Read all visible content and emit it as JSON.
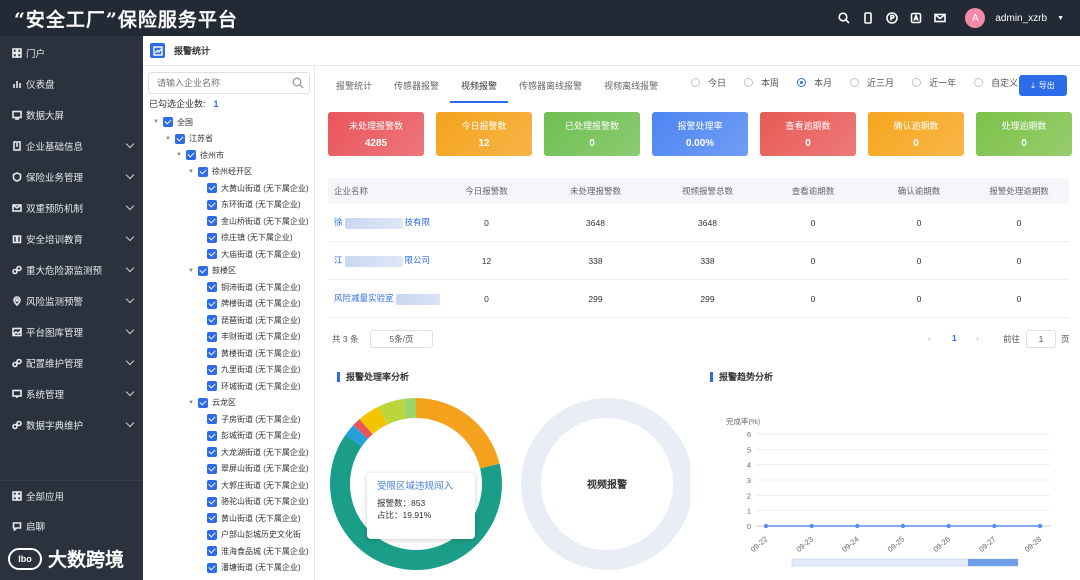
{
  "app": {
    "title": "“安全工厂”保险服务平台"
  },
  "user": {
    "avatar_letter": "A",
    "name": "admin_xzrb"
  },
  "sidebar": {
    "items": [
      {
        "label": "门户",
        "icon": "grid-icon"
      },
      {
        "label": "仪表盘",
        "icon": "chart-icon"
      },
      {
        "label": "数据大屏",
        "icon": "screen-icon"
      },
      {
        "label": "企业基础信息",
        "icon": "building-icon"
      },
      {
        "label": "保险业务管理",
        "icon": "shield-icon"
      },
      {
        "label": "双重预防机制",
        "icon": "mail-icon"
      },
      {
        "label": "安全培训教育",
        "icon": "book-icon"
      },
      {
        "label": "重大危险源监测预",
        "icon": "link-icon"
      },
      {
        "label": "风险监测预警",
        "icon": "pin-icon"
      },
      {
        "label": "平台图库管理",
        "icon": "image-icon"
      },
      {
        "label": "配置维护管理",
        "icon": "link-icon"
      },
      {
        "label": "系统管理",
        "icon": "monitor-icon"
      },
      {
        "label": "数据字典维护",
        "icon": "link-icon"
      }
    ],
    "bottom": [
      {
        "label": "全部应用",
        "icon": "apps-icon"
      },
      {
        "label": "启聊",
        "icon": "chat-icon"
      }
    ]
  },
  "watermark": {
    "text": "大数跨境",
    "logo": "lbo"
  },
  "page": {
    "title": "报警统计"
  },
  "tree": {
    "search_placeholder": "请输入企业名称",
    "selected_label": "已勾选企业数:",
    "selected_count": "1",
    "nodes": [
      {
        "label": "全国",
        "level": 0,
        "arrow": true
      },
      {
        "label": "江苏省",
        "level": 1,
        "arrow": true
      },
      {
        "label": "徐州市",
        "level": 2,
        "arrow": true
      },
      {
        "label": "徐州经开区",
        "level": 3,
        "arrow": true
      },
      {
        "label": "大黄山街道 (无下属企业)",
        "level": 4
      },
      {
        "label": "东环街道 (无下属企业)",
        "level": 4
      },
      {
        "label": "金山桥街道 (无下属企业)",
        "level": 4
      },
      {
        "label": "徐庄镇 (无下属企业)",
        "level": 4
      },
      {
        "label": "大庙街道 (无下属企业)",
        "level": 4
      },
      {
        "label": "鼓楼区",
        "level": 3,
        "arrow": true
      },
      {
        "label": "铜沛街道 (无下属企业)",
        "level": 4
      },
      {
        "label": "牌楼街道 (无下属企业)",
        "level": 4
      },
      {
        "label": "琵琶街道 (无下属企业)",
        "level": 4
      },
      {
        "label": "丰财街道 (无下属企业)",
        "level": 4
      },
      {
        "label": "黄楼街道 (无下属企业)",
        "level": 4
      },
      {
        "label": "九里街道 (无下属企业)",
        "level": 4
      },
      {
        "label": "环城街道 (无下属企业)",
        "level": 4
      },
      {
        "label": "云龙区",
        "level": 3,
        "arrow": true
      },
      {
        "label": "子房街道 (无下属企业)",
        "level": 4
      },
      {
        "label": "彭城街道 (无下属企业)",
        "level": 4
      },
      {
        "label": "大龙湖街道 (无下属企业)",
        "level": 4
      },
      {
        "label": "翠屏山街道 (无下属企业)",
        "level": 4
      },
      {
        "label": "大郭庄街道 (无下属企业)",
        "level": 4
      },
      {
        "label": "骆驼山街道 (无下属企业)",
        "level": 4
      },
      {
        "label": "黄山街道 (无下属企业)",
        "level": 4
      },
      {
        "label": "户部山彭城历史文化街",
        "level": 4
      },
      {
        "label": "淮海食品城 (无下属企业)",
        "level": 4
      },
      {
        "label": "潘塘街道 (无下属企业)",
        "level": 4
      }
    ]
  },
  "tabs": [
    "报警统计",
    "传感器报警",
    "视频报警",
    "传感器离线报警",
    "视频离线报警"
  ],
  "active_tab": 2,
  "radios": [
    "今日",
    "本周",
    "本月",
    "近三月",
    "近一年",
    "自定义"
  ],
  "active_radio": 2,
  "export_label": "导出",
  "cards": [
    {
      "label": "未处理报警数",
      "value": "4285",
      "color": "#e9545a"
    },
    {
      "label": "今日报警数",
      "value": "12",
      "color": "#f4a21b"
    },
    {
      "label": "已处理报警数",
      "value": "0",
      "color": "#6fbf50"
    },
    {
      "label": "报警处理率",
      "value": "0.00%",
      "color": "#4d85f2"
    },
    {
      "label": "查看逾期数",
      "value": "0",
      "color": "#e85a56"
    },
    {
      "label": "确认逾期数",
      "value": "0",
      "color": "#f6a51c"
    },
    {
      "label": "处理逾期数",
      "value": "0",
      "color": "#7cc148"
    }
  ],
  "table": {
    "headers": [
      "企业名称",
      "今日报警数",
      "未处理报警数",
      "视频报警总数",
      "查看逾期数",
      "确认逾期数",
      "报警处理逾期数"
    ],
    "rows": [
      {
        "name_a": "徐",
        "name_b": "技有限",
        "cells": [
          "0",
          "3648",
          "3648",
          "0",
          "0",
          "0"
        ]
      },
      {
        "name_a": "江",
        "name_b": "限公司",
        "cells": [
          "12",
          "338",
          "338",
          "0",
          "0",
          "0"
        ]
      },
      {
        "name_a": "风险减量实验室",
        "name_b": "",
        "cells": [
          "0",
          "299",
          "299",
          "0",
          "0",
          "0"
        ]
      }
    ]
  },
  "pager": {
    "total": "共 3 条",
    "size": "5条/页",
    "current": "1",
    "goto_label": "前往",
    "goto_value": "1",
    "page_unit": "页"
  },
  "panels": {
    "left_title": "报警处理率分析",
    "right_title": "报警趋势分析",
    "donut_center": "视频报警"
  },
  "tooltip": {
    "title": "受限区域违规闯入",
    "line1": "报警数：853",
    "line2": "占比：19.91%"
  },
  "chart_data": [
    {
      "type": "pie",
      "categories": [
        "受限区域违规闯入",
        "",
        "",
        "",
        "",
        "",
        ""
      ],
      "values": [
        19.91,
        59.5,
        2.2,
        1.5,
        4.0,
        4.5,
        2.2
      ],
      "colors": [
        "#f4a21b",
        "#1a9e88",
        "#26a0da",
        "#e9545a",
        "#f5c400",
        "#bcd53b",
        "#9bd56a"
      ]
    },
    {
      "type": "line",
      "title": "",
      "ylabel": "完成率(%)",
      "x": [
        "09-22",
        "09-23",
        "09-24",
        "09-25",
        "09-26",
        "09-27",
        "09-28"
      ],
      "series": [
        {
          "values": [
            0,
            0,
            0,
            0,
            0,
            0,
            0
          ]
        }
      ],
      "ylim": [
        0,
        6
      ],
      "yticks": [
        "0",
        "1",
        "2",
        "3",
        "4",
        "5",
        "6"
      ]
    }
  ],
  "colors": {
    "accent": "#2d6ce8",
    "sidebar_bg": "#2b323d",
    "topbar_bg": "#222a35"
  }
}
